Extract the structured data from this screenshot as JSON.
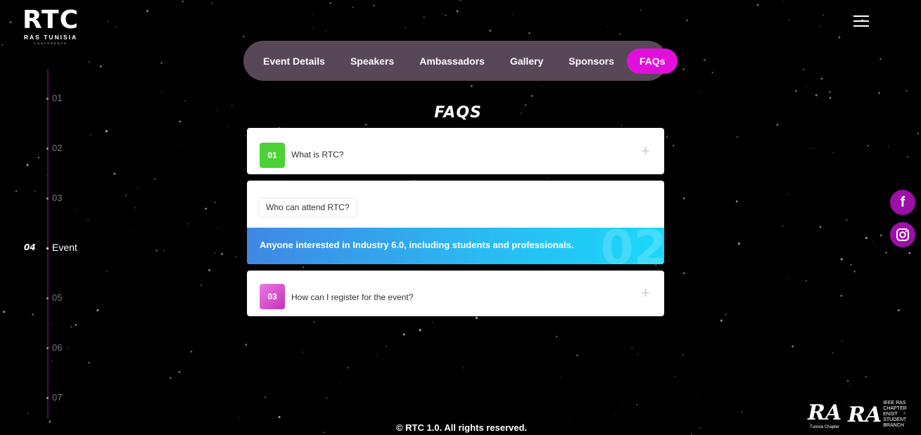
{
  "logo": {
    "main": "RTC",
    "sub": "RAS TUNISIA",
    "tiny": "CONFERENCE"
  },
  "nav": {
    "items": [
      {
        "label": "Event Details"
      },
      {
        "label": "Speakers"
      },
      {
        "label": "Ambassadors"
      },
      {
        "label": "Gallery"
      },
      {
        "label": "Sponsors"
      },
      {
        "label": "FAQs",
        "active": true
      }
    ]
  },
  "timeline": {
    "items": [
      "01",
      "02",
      "03",
      "05",
      "06",
      "07"
    ],
    "active_num": "04",
    "active_label": "Event"
  },
  "faq": {
    "title": "FAQS",
    "items": [
      {
        "num": "01",
        "question": "What is RTC?",
        "badge_color": "#4cd137"
      },
      {
        "num": "02",
        "question": "Who can attend RTC?",
        "answer": "Anyone interested in Industry 6.0, including students and professionals."
      },
      {
        "num": "03",
        "question": "How can I register for the event?",
        "badge_color": "#d444c9"
      }
    ],
    "plus": "+"
  },
  "social": {
    "facebook": "f",
    "instagram": "◎"
  },
  "footer": {
    "copyright": "© RTC 1.0. All rights reserved."
  },
  "partners": {
    "ras_tunisia": {
      "mark": "RA",
      "caption": "Tunisia Chapter"
    },
    "enstb": {
      "mark": "RA",
      "caption_line1": "IEEE RAS CHAPTER",
      "caption_line2": "ENSIT STUDENT BRANCH"
    }
  },
  "colors": {
    "accent": "#e20fdc",
    "nav_bg": "#574757",
    "answer_start": "#4087e4",
    "answer_end": "#1ad8fa",
    "social": "#9c0fa8"
  }
}
